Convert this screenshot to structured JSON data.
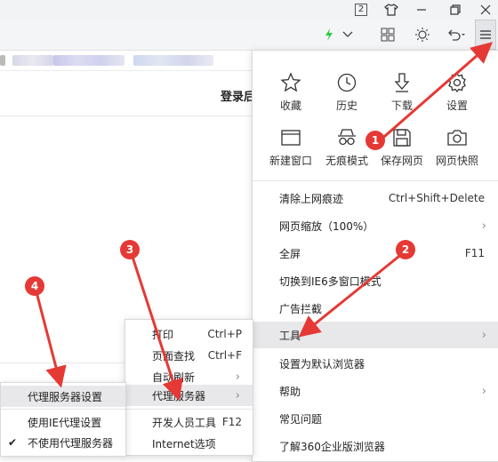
{
  "titlebar": {
    "badge_number": "2",
    "icons": [
      "counter-icon",
      "shirt-icon",
      "minimize-icon",
      "restore-icon",
      "close-icon"
    ]
  },
  "toolbar": {
    "icons": [
      "lightning-icon",
      "chevron-down-icon",
      "grid-icon",
      "brightness-icon",
      "undo-icon",
      "menu-icon"
    ]
  },
  "page": {
    "login_text": "登录后"
  },
  "quick_actions": [
    {
      "label": "收藏",
      "icon": "star-icon"
    },
    {
      "label": "历史",
      "icon": "clock-icon"
    },
    {
      "label": "下载",
      "icon": "download-icon"
    },
    {
      "label": "设置",
      "icon": "gear-icon"
    },
    {
      "label": "新建窗口",
      "icon": "window-icon"
    },
    {
      "label": "无痕模式",
      "icon": "incognito-icon"
    },
    {
      "label": "保存网页",
      "icon": "save-icon"
    },
    {
      "label": "网页快照",
      "icon": "camera-icon"
    }
  ],
  "main_menu": [
    {
      "label": "清除上网痕迹",
      "shortcut": "Ctrl+Shift+Delete"
    },
    {
      "label": "网页缩放（100%）",
      "shortcut": ""
    },
    {
      "label": "全屏",
      "shortcut": "F11"
    },
    {
      "label": "切换到IE6多窗口模式",
      "shortcut": ""
    },
    {
      "label": "广告拦截",
      "shortcut": ""
    },
    {
      "label": "工具",
      "shortcut": ""
    },
    {
      "label": "设置为默认浏览器",
      "shortcut": ""
    },
    {
      "label": "帮助",
      "shortcut": ""
    },
    {
      "label": "常见问题",
      "shortcut": ""
    },
    {
      "label": "了解360企业版浏览器",
      "shortcut": ""
    }
  ],
  "tools_menu": [
    {
      "label": "打印",
      "shortcut": "Ctrl+P"
    },
    {
      "label": "页面查找",
      "shortcut": "Ctrl+F"
    },
    {
      "label": "自动刷新",
      "shortcut": ""
    },
    {
      "label": "代理服务器",
      "shortcut": ""
    },
    {
      "label": "开发人员工具",
      "shortcut": "F12"
    },
    {
      "label": "Internet选项",
      "shortcut": ""
    }
  ],
  "proxy_menu": [
    {
      "label": "代理服务器设置"
    },
    {
      "label": "使用IE代理设置"
    },
    {
      "label": "不使用代理服务器",
      "checkmark": "✔"
    }
  ],
  "annotations": [
    "1",
    "2",
    "3",
    "4"
  ],
  "colors": {
    "annotation": "#e53935",
    "highlight": "#e8e8ea",
    "lightning": "#2ecc40"
  }
}
